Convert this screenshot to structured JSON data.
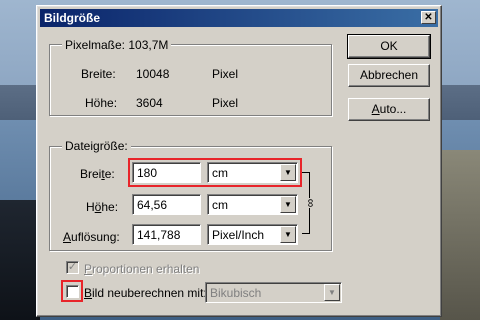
{
  "dialog": {
    "title": "Bildgröße",
    "close_symbol": "✕"
  },
  "pixel_section": {
    "title": "Pixelmaße: 103,7M",
    "rows": [
      {
        "label": "Breite:",
        "value": "10048",
        "unit": "Pixel"
      },
      {
        "label": "Höhe:",
        "value": "3604",
        "unit": "Pixel"
      }
    ]
  },
  "buttons": {
    "ok": "OK",
    "cancel": "Abbrechen",
    "auto": "Auto..."
  },
  "file_section": {
    "title": "Dateigröße:",
    "width": {
      "label": "Breite:",
      "value": "180",
      "unit": "cm"
    },
    "height": {
      "label": "Höhe:",
      "value": "64,56",
      "unit": "cm"
    },
    "resolution": {
      "label": "Auflösung:",
      "value": "141,788",
      "unit": "Pixel/Inch"
    },
    "link_icon": "chain-link-icon",
    "link_symbol": "∞"
  },
  "options": {
    "constrain": {
      "label": "Proportionen erhalten",
      "checked": true,
      "enabled": false
    },
    "resample": {
      "label": "Bild neuberechnen mit:",
      "checked": false
    },
    "resample_method": "Bikubisch"
  },
  "dropdown_arrow": "▼",
  "checkmark": "✓",
  "highlight_color": "#e8242a",
  "title_bar_color": "#0a246a"
}
